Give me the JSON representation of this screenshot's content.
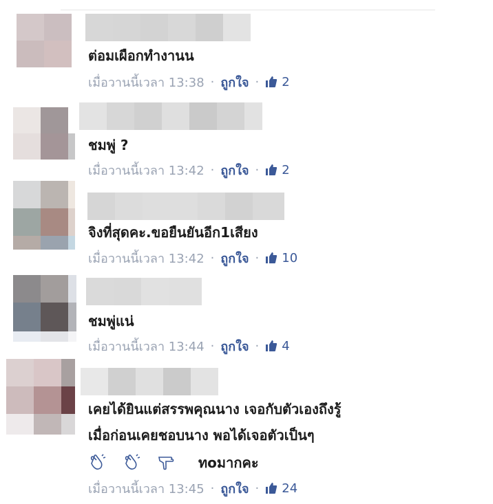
{
  "comments": [
    {
      "text": "ต่อมเผือกทำงานน",
      "time": "เมื่อวานนี้เวลา 13:38",
      "like_label": "ถูกใจ",
      "like_count": "2",
      "avatar_colors": [
        "#d4c8c9",
        "#cbbec0",
        "#cbbcbd",
        "#d2bfbf"
      ],
      "blur_colors": [
        "#d7d7d7",
        "#d6d6d6",
        "#d3d3d3",
        "#d8d8d8",
        "#cfcfcf",
        "#e3e3e3"
      ]
    },
    {
      "text": "ชมพู่ ?",
      "time": "เมื่อวานนี้เวลา 13:42",
      "like_label": "ถูกใจ",
      "like_count": "2",
      "avatar_colors": [
        "#ebe6e4",
        "#a09799",
        "#e5dedd",
        "#a49598",
        "#ffffff",
        "#c7c7c8"
      ],
      "blur_colors": [
        "#e3e3e3",
        "#d7d7d7",
        "#d0d0d0",
        "#dfdfdf",
        "#cacaca",
        "#d4d4d4",
        "#e2e2e2"
      ]
    },
    {
      "text": "จิงที่สุดคะ.ขอยืนยันอีก1เสียง",
      "time": "เมื่อวานนี้เวลา 13:42",
      "like_label": "ถูกใจ",
      "like_count": "10",
      "avatar_colors": [
        "#d7d8d9",
        "#bbb5b1",
        "#eee7e0",
        "#9da6a3",
        "#a88a83",
        "#ddd1cb",
        "#b5aba6",
        "#9aa3ae",
        "#c4d7e2"
      ],
      "blur_colors": [
        "#d6d6d6",
        "#dcdcdc",
        "#dedede",
        "#dadada",
        "#d2d2d2",
        "#d9d9d9"
      ]
    },
    {
      "text": "ชมพู่แน่",
      "time": "เมื่อวานนี้เวลา 13:44",
      "like_label": "ถูกใจ",
      "like_count": "4",
      "avatar_colors": [
        "#8c8a8c",
        "#a29d9c",
        "#dde0e6",
        "#76808c",
        "#5e5758",
        "#b2b3b8",
        "#e8ecf2",
        "#e3e4e8",
        "#f4f4f6"
      ],
      "blur_colors": [
        "#dadada",
        "#d9d9d9",
        "#e1e1e1",
        "#e0e0e0"
      ]
    },
    {
      "text_lines": [
        "เคยได้ยินแต่สรรพคุณนาง เจอกับตัวเองถึงรู้",
        "เมื่อก่อนเคยชอบนาง พอได้เจอตัวเป็นๆ"
      ],
      "emoji_text": "ทoมากคะ",
      "time": "เมื่อวานนี้เวลา 13:45",
      "like_label": "ถูกใจ",
      "like_count": "24",
      "avatar_colors": [
        "#dcd0d0",
        "#d9c6c7",
        "#a8a0a0",
        "#cdbbbc",
        "#b49394",
        "#6b4247",
        "#eeeaeb",
        "#c1b7b7",
        "#d9d7d8"
      ],
      "blur_colors": [
        "#e8e8e8",
        "#d0d0d0",
        "#e0e0e0",
        "#cbcbcb",
        "#e3e3e3"
      ]
    }
  ],
  "icons": {
    "like": "thumbs-up-icon",
    "emoji1": "clapping-hand-icon",
    "emoji2": "clapping-hand-icon",
    "emoji3": "thumbs-down-icon"
  },
  "colors": {
    "link": "#3b5998",
    "meta": "#9aa3b3"
  }
}
